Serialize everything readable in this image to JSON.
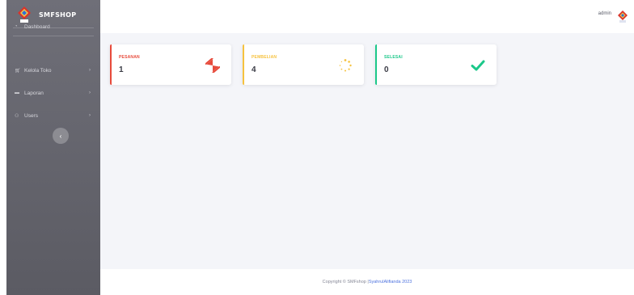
{
  "brand": {
    "name": "SMFSHOP"
  },
  "sidebar": {
    "items": [
      {
        "label": "Dashboard",
        "icon": "dashboard-icon",
        "has_submenu": false
      },
      {
        "label": "Kelola Toko",
        "icon": "cart-icon",
        "has_submenu": true
      },
      {
        "label": "Laporan",
        "icon": "folder-icon",
        "has_submenu": true
      },
      {
        "label": "Users",
        "icon": "users-icon",
        "has_submenu": true
      }
    ],
    "toggle_icon": "chevron-left-icon"
  },
  "topbar": {
    "user_name": "admin"
  },
  "cards": [
    {
      "label": "PESANAN",
      "value": "1",
      "color": "#e74a3b",
      "icon": "hourglass-icon"
    },
    {
      "label": "PEMBELIAN",
      "value": "4",
      "color": "#f6c23e",
      "icon": "spinner-icon"
    },
    {
      "label": "SELESAI",
      "value": "0",
      "color": "#1cc88a",
      "icon": "check-icon"
    }
  ],
  "footer": {
    "text": "Copyright © SMFshop | ",
    "link": "SyahrulAlifianda 2023"
  },
  "colors": {
    "primary": "#4e73df",
    "sidebar": "#66666e",
    "background": "#f4f5f9"
  }
}
